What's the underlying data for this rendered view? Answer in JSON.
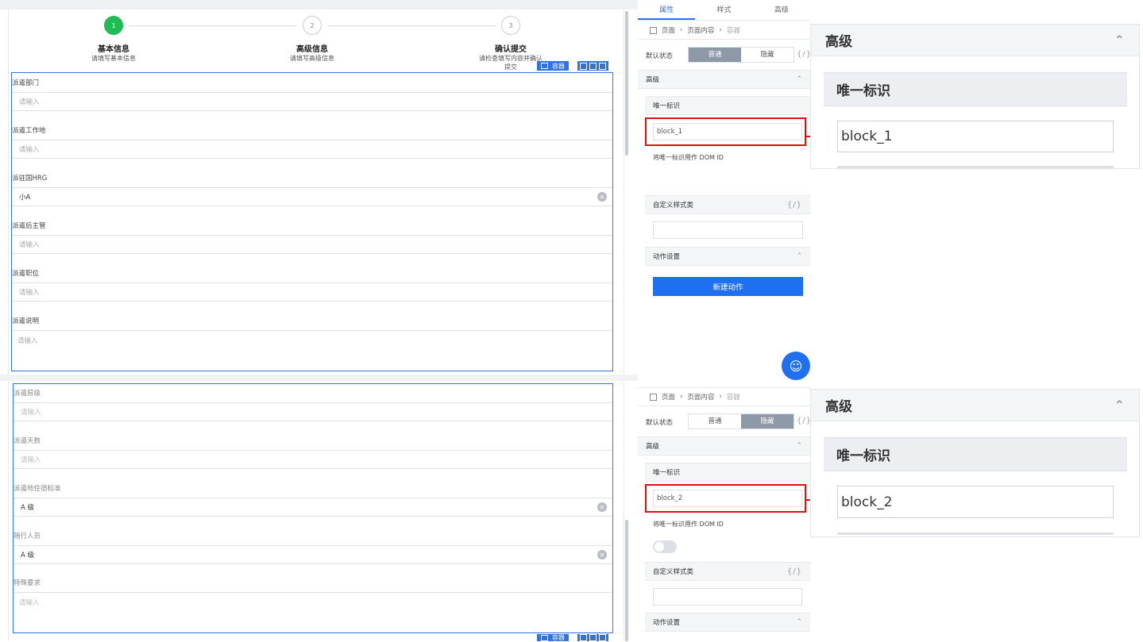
{
  "steps": [
    {
      "num": "1",
      "title": "基本信息",
      "desc": "请填写基本信息"
    },
    {
      "num": "2",
      "title": "高级信息",
      "desc": "请填写高级信息"
    },
    {
      "num": "3",
      "title": "确认提交",
      "desc": "请检查填写内容并确认提交"
    }
  ],
  "container_badge": "容器",
  "form1": [
    {
      "label": "派遣部门",
      "value": "请输入"
    },
    {
      "label": "派遣工作地",
      "value": "请输入"
    },
    {
      "label": "派驻国HRG",
      "value": "小A"
    },
    {
      "label": "派遣后主管",
      "value": "请输入"
    },
    {
      "label": "派遣职位",
      "value": "请输入"
    },
    {
      "label": "派遣说明",
      "value": "请输入"
    }
  ],
  "form2": [
    {
      "label": "派遣层级",
      "value": "请输入"
    },
    {
      "label": "派遣天数",
      "value": "请输入"
    },
    {
      "label": "派遣地住宿标准",
      "value": "A 级"
    },
    {
      "label": "随行人员",
      "value": "A 级"
    },
    {
      "label": "特殊要求",
      "value": "请输入"
    }
  ],
  "panel": {
    "tabs": [
      "属性",
      "样式",
      "高级"
    ],
    "crumb": [
      "页面",
      "页面内容",
      "容器"
    ],
    "default_state_label": "默认状态",
    "state_options": [
      "普通",
      "隐藏"
    ],
    "advanced": "高级",
    "unique_id": "唯一标识",
    "use_as_dom": "将唯一标识用作 DOM ID",
    "custom_class": "自定义样式类",
    "action_settings": "动作设置",
    "new_action": "新建动作",
    "braces": "{/}",
    "top_value": "block_1",
    "bottom_value": "block_2"
  },
  "zoom": {
    "title": "高级",
    "sub": "唯一标识",
    "top_value": "block_1",
    "bottom_value": "block_2"
  },
  "colors": {
    "accent": "#2f73e0",
    "step_active": "#1fbc55",
    "highlight": "#e01010"
  }
}
